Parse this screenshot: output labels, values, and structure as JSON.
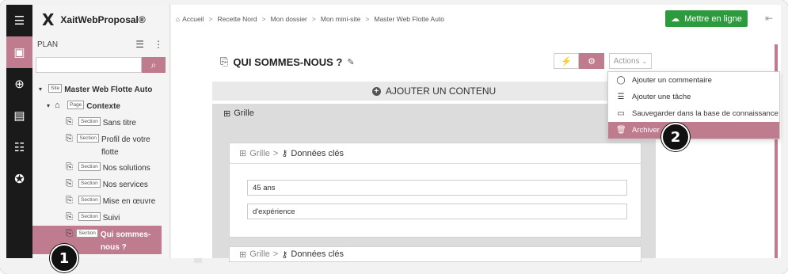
{
  "brand": {
    "name": "XaitWebProposal®"
  },
  "plan": {
    "label": "PLAN"
  },
  "search": {
    "placeholder": "",
    "button_icon": "search-icon"
  },
  "tree": [
    {
      "tag": "Site",
      "label": "Master Web Flotte Auto",
      "bold": true,
      "indent": 0,
      "toggle": "▾"
    },
    {
      "tag": "Page",
      "label": "Contexte",
      "bold": true,
      "indent": 1,
      "toggle": "▾"
    },
    {
      "tag": "Section",
      "label": "Sans titre",
      "indent": 2
    },
    {
      "tag": "Section",
      "label": "Profil de votre flotte",
      "indent": 2
    },
    {
      "tag": "Section",
      "label": "Nos solutions",
      "indent": 2
    },
    {
      "tag": "Section",
      "label": "Nos services",
      "indent": 2
    },
    {
      "tag": "Section",
      "label": "Mise en œuvre",
      "indent": 2
    },
    {
      "tag": "Section",
      "label": "Suivi",
      "indent": 2
    },
    {
      "tag": "Section",
      "label": "Qui sommes-nous ?",
      "indent": 2,
      "selected": true
    }
  ],
  "breadcrumb": [
    "Accueil",
    "Recette Nord",
    "Mon dossier",
    "Mon mini-site",
    "Master Web Flotte Auto"
  ],
  "publish": {
    "label": "Mettre en ligne"
  },
  "page": {
    "title": "QUI SOMMES-NOUS ?"
  },
  "actions": {
    "label": "Actions"
  },
  "add_content": {
    "label": "AJOUTER UN CONTENU"
  },
  "grid": {
    "label": "Grille"
  },
  "card": {
    "crumb_a": "Grille",
    "crumb_b": "Données clés",
    "field1": "45 ans",
    "field2": "d'expérience"
  },
  "card2": {
    "crumb_a": "Grille",
    "crumb_b": "Données clés"
  },
  "menu": [
    {
      "icon": "comment-icon",
      "label": "Ajouter un commentaire"
    },
    {
      "icon": "task-icon",
      "label": "Ajouter une tâche"
    },
    {
      "icon": "book-icon",
      "label": "Sauvegarder dans la base de connaissance"
    },
    {
      "icon": "trash-icon",
      "label": "Archiver",
      "highlight": true
    }
  ],
  "callouts": [
    "1",
    "2"
  ],
  "colors": {
    "accent": "#c07c8f",
    "publish": "#2e9a3e",
    "rail": "#1a1a1a"
  }
}
